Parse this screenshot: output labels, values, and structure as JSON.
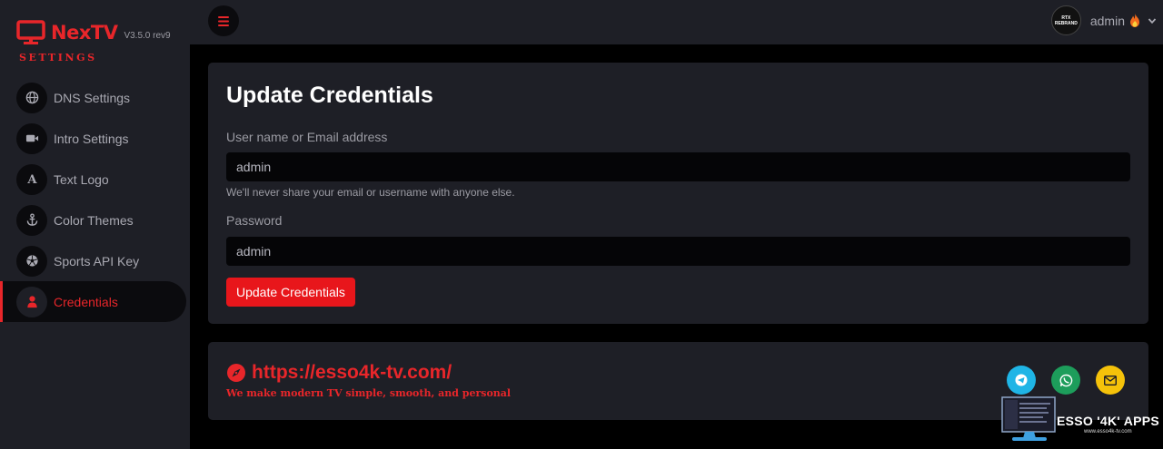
{
  "brand": {
    "name": "NexTV",
    "version": "V3.5.0 rev9",
    "section": "SETTINGS",
    "color": "#e8262a"
  },
  "sidebar": {
    "items": [
      {
        "label": "DNS Settings",
        "icon": "globe-icon",
        "active": false
      },
      {
        "label": "Intro Settings",
        "icon": "video-camera-icon",
        "active": false
      },
      {
        "label": "Text Logo",
        "icon": "letter-a-icon",
        "active": false
      },
      {
        "label": "Color Themes",
        "icon": "anchor-icon",
        "active": false
      },
      {
        "label": "Sports API Key",
        "icon": "soccer-ball-icon",
        "active": false
      },
      {
        "label": "Credentials",
        "icon": "user-icon",
        "active": true
      }
    ]
  },
  "header": {
    "menu_icon": "hamburger-icon",
    "avatar_text_1": "RTX",
    "avatar_text_2": "REBRAND",
    "user_name": "admin"
  },
  "credentials": {
    "title": "Update Credentials",
    "username_label": "User name or Email address",
    "username_value": "admin",
    "help_text": "We'll never share your email or username with anyone else.",
    "password_label": "Password",
    "password_value": "admin",
    "submit_label": "Update Credentials"
  },
  "promo": {
    "url": "https://esso4k-tv.com/",
    "tagline": "We make modern TV simple, smooth, and personal",
    "social": [
      {
        "icon": "telegram-icon",
        "color": "#1fb5e6"
      },
      {
        "icon": "whatsapp-icon",
        "color": "#1d9d5b"
      },
      {
        "icon": "email-icon",
        "color": "#f5c20a"
      }
    ]
  },
  "watermark": {
    "text": "ESSO '4K' APPS",
    "sub": "www.esso4k-tv.com"
  }
}
